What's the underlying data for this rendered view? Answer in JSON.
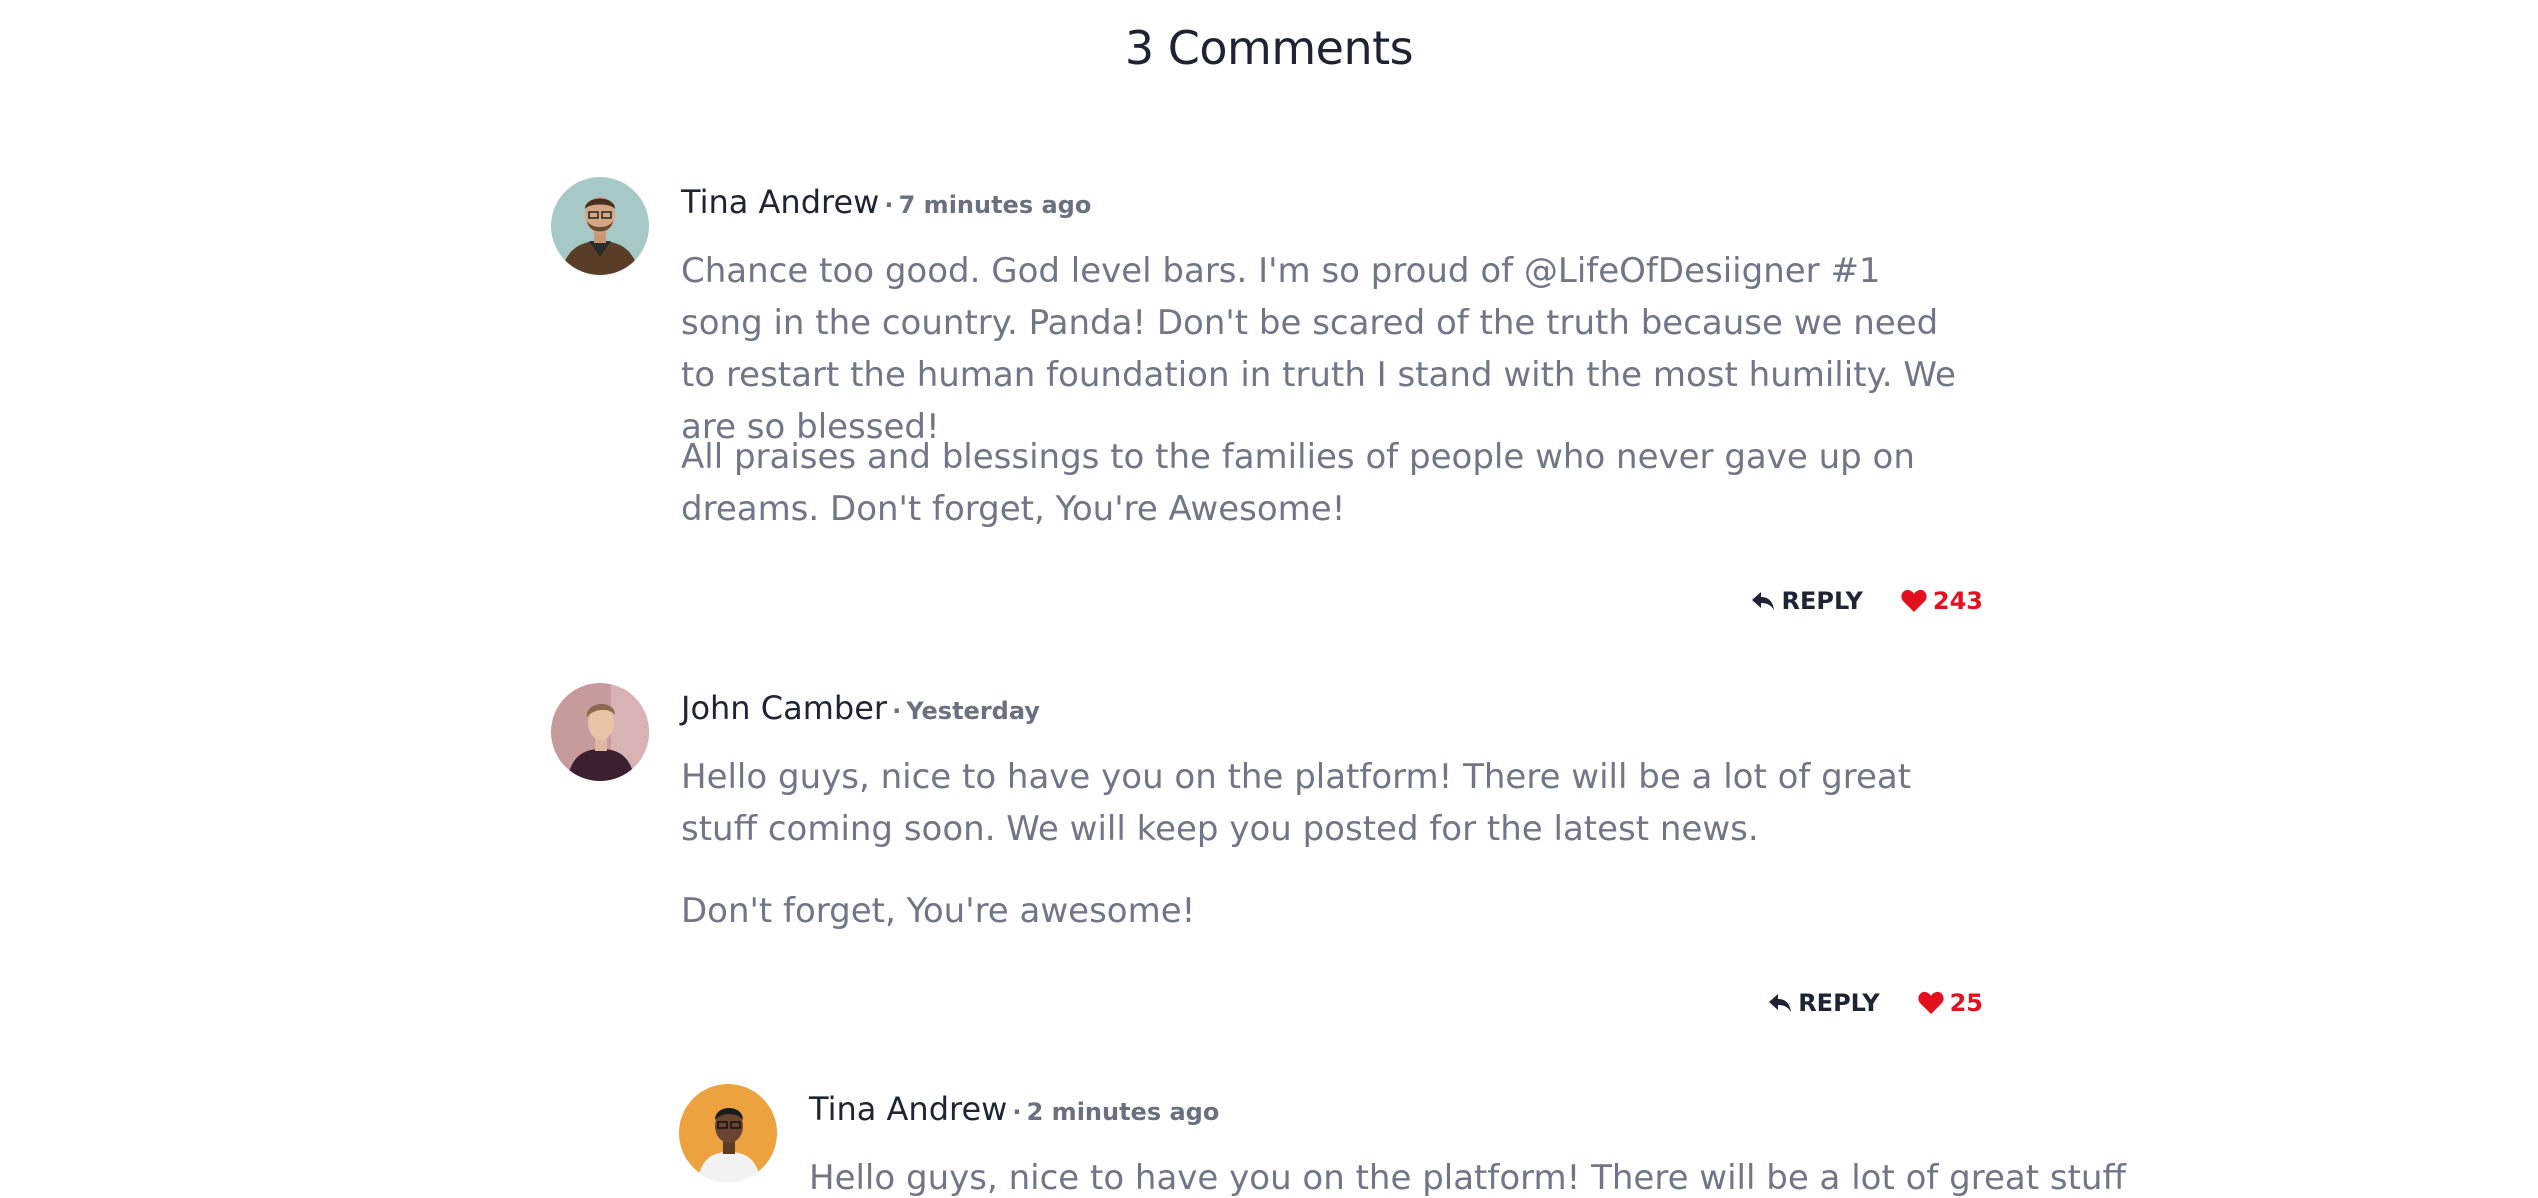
{
  "section": {
    "title": "3 Comments"
  },
  "comments": [
    {
      "author": "Tina Andrew",
      "separator": "·",
      "time": "7 minutes ago",
      "paragraphs": [
        "Chance too good. God level bars. I'm so proud of @LifeOfDesiigner #1 song in the country. Panda! Don't be scared of the truth because we need to restart the human foundation in truth I stand with the most humility. We are so blessed!",
        "All praises and blessings to the families of people who never gave up on dreams. Don't forget, You're Awesome!"
      ],
      "reply_label": "REPLY",
      "likes": "243",
      "avatar_bg": "#a6c9c8"
    },
    {
      "author": "John Camber",
      "separator": "·",
      "time": "Yesterday",
      "paragraphs": [
        "Hello guys, nice to have you on the platform! There will be a lot of great stuff coming soon. We will keep you posted for the latest news.",
        "Don't forget, You're awesome!"
      ],
      "reply_label": "REPLY",
      "likes": "25",
      "avatar_bg": "#c79a9c"
    },
    {
      "author": "Tina Andrew",
      "separator": "·",
      "time": "2 minutes ago",
      "paragraphs": [
        "Hello guys, nice to have you on the platform! There will be a lot of great stuff"
      ],
      "avatar_bg": "#eba23f"
    }
  ],
  "icons": {
    "reply": "reply-arrow-icon",
    "like": "heart-icon"
  },
  "colors": {
    "like": "#e3111e",
    "heading": "#1f2434",
    "body_text": "#707688"
  }
}
